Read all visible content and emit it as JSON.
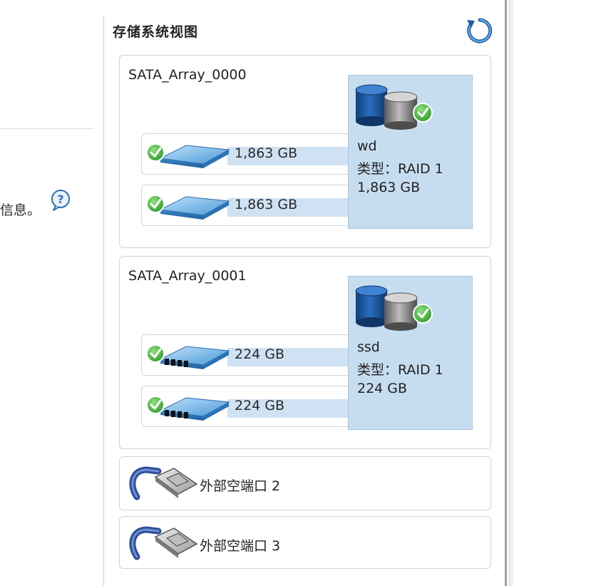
{
  "left": {
    "info_text": "信息。"
  },
  "panel": {
    "title": "存储系统视图"
  },
  "arrays": [
    {
      "name": "SATA_Array_0000",
      "disks": [
        {
          "size": "1,863 GB"
        },
        {
          "size": "1,863 GB"
        }
      ],
      "volume": {
        "name": "wd",
        "type": "类型：RAID 1",
        "size": "1,863 GB"
      }
    },
    {
      "name": "SATA_Array_0001",
      "disks": [
        {
          "size": "224 GB"
        },
        {
          "size": "224 GB"
        }
      ],
      "volume": {
        "name": "ssd",
        "type": "类型：RAID 1",
        "size": "224 GB"
      }
    }
  ],
  "ports": [
    {
      "label": "外部空端口 2"
    },
    {
      "label": "外部空端口 3"
    }
  ],
  "colors": {
    "ok_green": "#3fae3a",
    "volume_bg": "#c6ddf0",
    "disk_blue": "#4f9ed6",
    "accent_blue": "#2f6fb0"
  }
}
